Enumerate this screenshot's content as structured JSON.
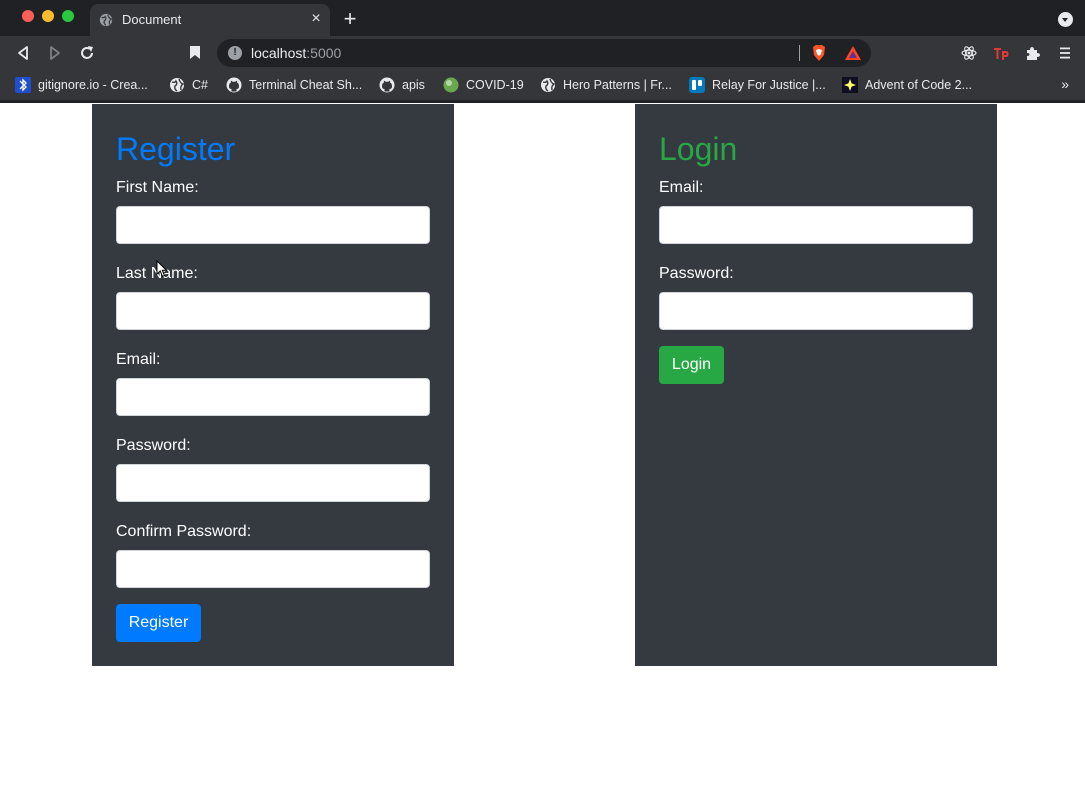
{
  "browser": {
    "tab_title": "Document",
    "new_tab_symbol": "+",
    "close_symbol": "×",
    "url_host": "localhost",
    "url_port": ":5000",
    "info_symbol": "!",
    "bookmarks": [
      {
        "label": "gitignore.io - Crea...",
        "icon": "bluetooth-like-icon"
      },
      {
        "label": "C#",
        "icon": "globe-icon"
      },
      {
        "label": "Terminal Cheat Sh...",
        "icon": "github-icon"
      },
      {
        "label": "apis",
        "icon": "github-icon"
      },
      {
        "label": "COVID-19",
        "icon": "green-orb-icon"
      },
      {
        "label": "Hero Patterns | Fr...",
        "icon": "globe-icon"
      },
      {
        "label": "Relay For Justice |...",
        "icon": "trello-icon"
      },
      {
        "label": "Advent of Code 2...",
        "icon": "star-icon"
      }
    ],
    "bookmarks_overflow": "»"
  },
  "register": {
    "title": "Register",
    "first_name_label": "First Name:",
    "last_name_label": "Last Name:",
    "email_label": "Email:",
    "password_label": "Password:",
    "confirm_password_label": "Confirm Password:",
    "submit_label": "Register"
  },
  "login": {
    "title": "Login",
    "email_label": "Email:",
    "password_label": "Password:",
    "submit_label": "Login"
  },
  "colors": {
    "register_accent": "#007bff",
    "login_accent": "#28a745",
    "card_bg": "#343a40"
  }
}
